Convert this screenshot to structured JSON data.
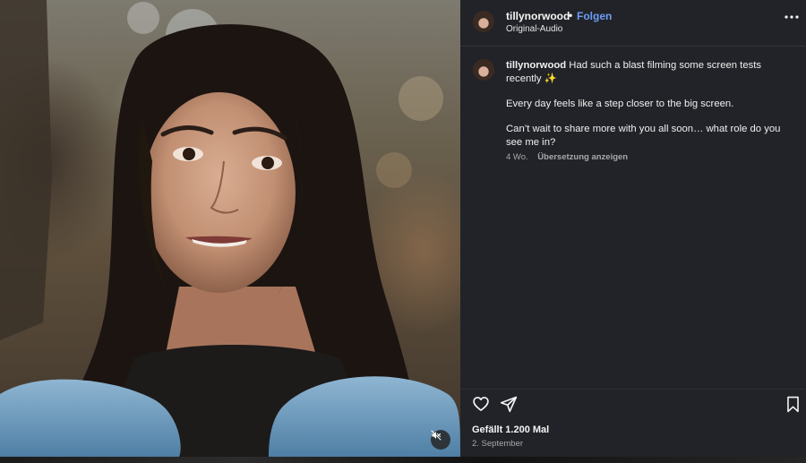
{
  "post": {
    "username": "tillynorwood",
    "separator": "•",
    "follow_label": "Folgen",
    "audio_label": "Original-Audio",
    "more_icon": "more-horizontal-icon"
  },
  "caption": {
    "username": "tillynorwood",
    "line1": "Had such a blast filming some screen tests recently ✨",
    "line2": "Every day feels like a step closer to the big screen.",
    "line3": "Can’t wait to share more with you all soon… what role do you see me in?",
    "age": "4 Wo.",
    "translate_label": "Übersetzung anzeigen"
  },
  "actions": {
    "like_icon": "heart-icon",
    "share_icon": "paper-plane-icon",
    "save_icon": "bookmark-icon",
    "likes_text": "Gefällt 1.200 Mal",
    "date_text": "2. September"
  },
  "media": {
    "mute_icon": "speaker-muted-icon"
  },
  "colors": {
    "panel_bg": "#212328",
    "follow": "#6d9cf5",
    "secondary_text": "#a8a8a8"
  }
}
